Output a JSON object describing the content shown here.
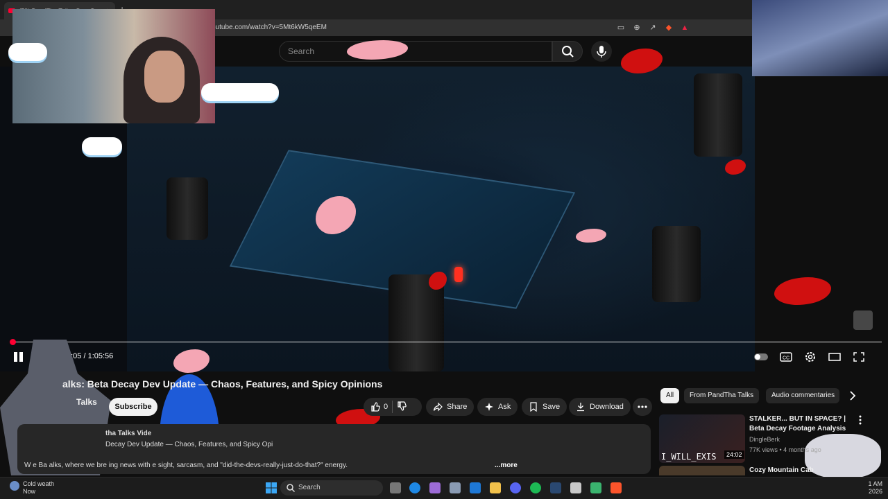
{
  "browser": {
    "tab_title": "(78) PandTha Talks: Beta Dec",
    "tab_close": "×",
    "new_tab": "+",
    "url": "youtube.com/watch?v=5Mt6kW5qeEM"
  },
  "youtube": {
    "search_placeholder": "Search"
  },
  "player": {
    "time_display": "0:05 / 1:05:56",
    "progress_fraction": 0.002
  },
  "video": {
    "title": "alks: Beta Decay Dev Update — Chaos, Features, and Spicy Opinions",
    "channel": "Talks",
    "subscribe_label": "Subscribe",
    "like_count": "0",
    "share_label": "Share",
    "ask_label": "Ask",
    "save_label": "Save",
    "download_label": "Download",
    "desc_views": "tha Talks Vide",
    "desc_title": "Decay Dev Update — Chaos, Features, and Spicy Opi",
    "desc_text": "W        e Ba          alks, where we bre          ing news with e          sight, sarcasm, and \"did-the-devs-really-just-do-that?\" energy.",
    "desc_more": "...more"
  },
  "sidebar": {
    "chips": [
      "All",
      "From PandTha Talks",
      "Audio commentaries"
    ],
    "recommendations": [
      {
        "title": "STALKER... BUT IN SPACE? | Beta Decay Footage Analysis",
        "channel": "DingleBerk",
        "meta": "77K views • 4 months ago",
        "duration": "24:02",
        "thumb_text": "I_WILL_EXIS"
      },
      {
        "title": "Cozy Mountain Cab"
      }
    ]
  },
  "taskbar": {
    "weather_title": "Cold weath",
    "weather_sub": "Now",
    "search_label": "Search",
    "clock_time": "1 AM",
    "clock_date": "2026"
  },
  "colors": {
    "accent": "#ff0033",
    "background": "#0f0f0f"
  }
}
